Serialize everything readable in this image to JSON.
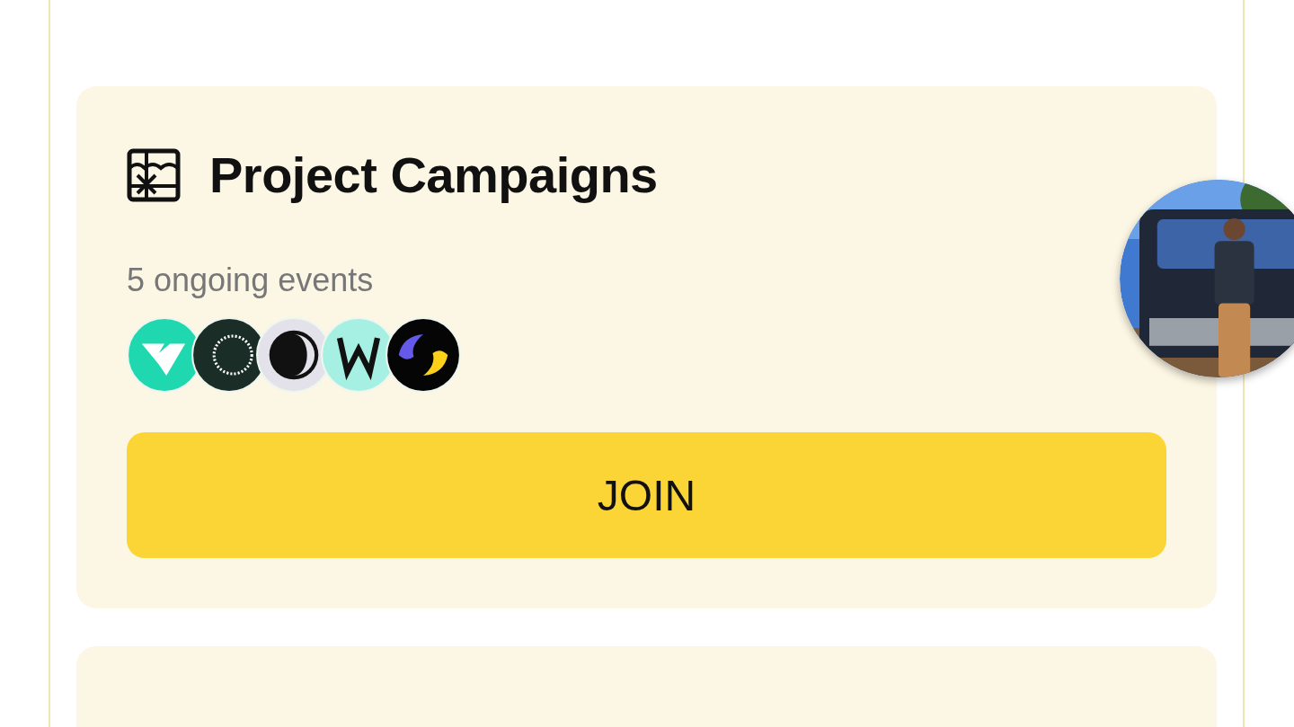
{
  "cards": [
    {
      "title": "Project Campaigns",
      "subtitle": "5 ongoing events",
      "button": "JOIN"
    }
  ]
}
